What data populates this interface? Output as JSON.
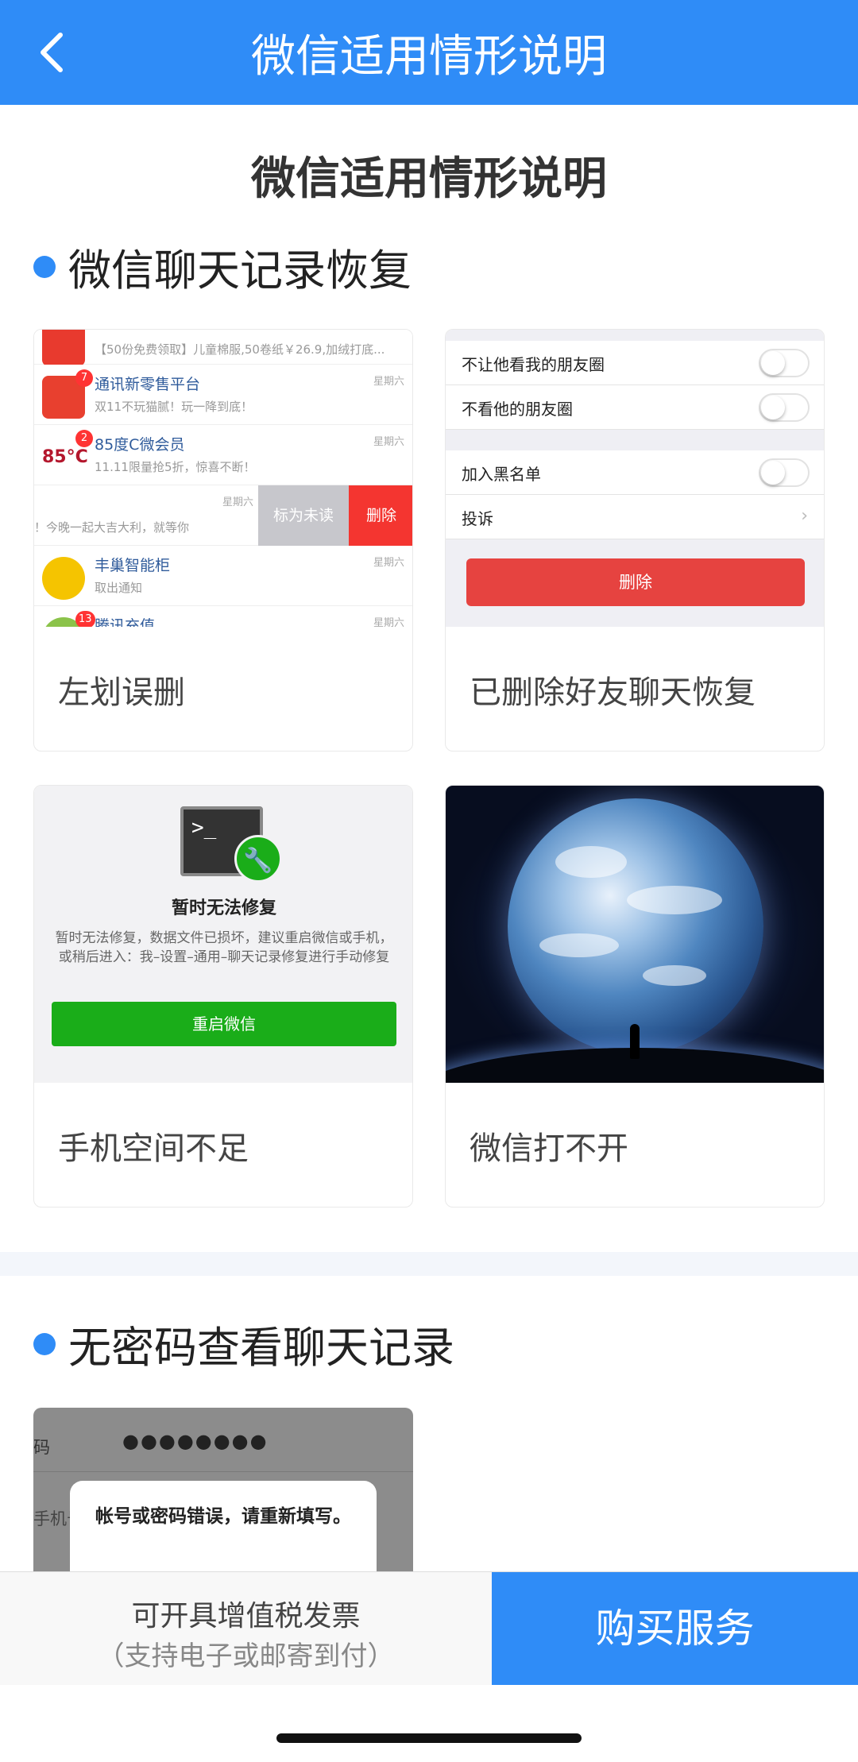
{
  "header": {
    "title": "微信适用情形说明"
  },
  "page_title": "微信适用情形说明",
  "section1": {
    "title": "微信聊天记录恢复",
    "cards": [
      {
        "caption": "左划误删"
      },
      {
        "caption": "已删除好友聊天恢复"
      },
      {
        "caption": "手机空间不足"
      },
      {
        "caption": "微信打不开"
      }
    ]
  },
  "chat_list": {
    "row0_sub": "【50份免费领取】儿童棉服,50卷纸￥26.9,加绒打底...",
    "row1": {
      "name": "通讯新零售平台",
      "sub": "双11不玩猫腻！玩一降到底！",
      "time": "星期六",
      "badge": "7"
    },
    "row2": {
      "name": "85度C微会员",
      "sub": "11.11限量抢5折，惊喜不断！",
      "time": "星期六",
      "badge": "2",
      "logo": "85°C"
    },
    "row3": {
      "sub": "！今晚一起大吉大利，就等你",
      "time": "星期六",
      "mark_unread": "标为未读",
      "delete": "删除"
    },
    "row4": {
      "name": "丰巢智能柜",
      "sub": "取出通知",
      "time": "星期六"
    },
    "row5": {
      "name": "腾讯充值",
      "time": "星期六",
      "badge": "13"
    }
  },
  "friend_settings": {
    "hide_moments": "不让他看我的朋友圈",
    "block_moments": "不看他的朋友圈",
    "blacklist": "加入黑名单",
    "report": "投诉",
    "delete": "删除"
  },
  "repair": {
    "terminal": ">_",
    "title": "暂时无法修复",
    "desc": "暂时无法修复，数据文件已损坏，建议重启微信或手机，或稍后进入：我–设置–通用–聊天记录修复进行手动修复",
    "button": "重启微信"
  },
  "section2": {
    "title": "无密码查看聊天记录"
  },
  "login_error": {
    "label1": "码",
    "password_mask": "●●●●●●●●",
    "label2": "手机号",
    "alert": "帐号或密码错误，请重新填写。"
  },
  "bottom": {
    "invoice_line1": "可开具增值税发票",
    "invoice_line2": "（支持电子或邮寄到付）",
    "buy": "购买服务"
  },
  "colors": {
    "accent": "#2f8cf7",
    "danger": "#e64340",
    "wechat_green": "#1aad19"
  }
}
